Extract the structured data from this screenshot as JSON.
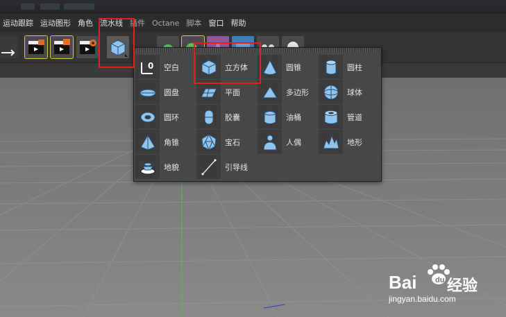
{
  "menu": [
    "运动跟踪",
    "运动图形",
    "角色",
    "流水线",
    "插件",
    "Octane",
    "脚本",
    "窗口",
    "帮助"
  ],
  "dropdown": {
    "items": [
      {
        "label": "空白",
        "icon": "null-object-icon"
      },
      {
        "label": "立方体",
        "icon": "cube-icon"
      },
      {
        "label": "圆锥",
        "icon": "cone-icon"
      },
      {
        "label": "圆柱",
        "icon": "cylinder-icon"
      },
      {
        "label": "圆盘",
        "icon": "disc-icon"
      },
      {
        "label": "平面",
        "icon": "plane-icon"
      },
      {
        "label": "多边形",
        "icon": "polygon-icon"
      },
      {
        "label": "球体",
        "icon": "sphere-icon"
      },
      {
        "label": "圆环",
        "icon": "torus-icon"
      },
      {
        "label": "胶囊",
        "icon": "capsule-icon"
      },
      {
        "label": "油桶",
        "icon": "oil-tank-icon"
      },
      {
        "label": "管道",
        "icon": "tube-icon"
      },
      {
        "label": "角锥",
        "icon": "pyramid-icon"
      },
      {
        "label": "宝石",
        "icon": "platonic-icon"
      },
      {
        "label": "人偶",
        "icon": "figure-icon"
      },
      {
        "label": "地形",
        "icon": "landscape-icon"
      },
      {
        "label": "地貌",
        "icon": "relief-icon"
      },
      {
        "label": "引导线",
        "icon": "guide-icon"
      }
    ]
  },
  "watermark": {
    "brand_left": "Bai",
    "brand_right": "经验",
    "url": "jingyan.baidu.com"
  },
  "colors": {
    "highlight": "#e0211f",
    "icon_blue": "#7fb8e6",
    "menu_bg": "#474747"
  }
}
